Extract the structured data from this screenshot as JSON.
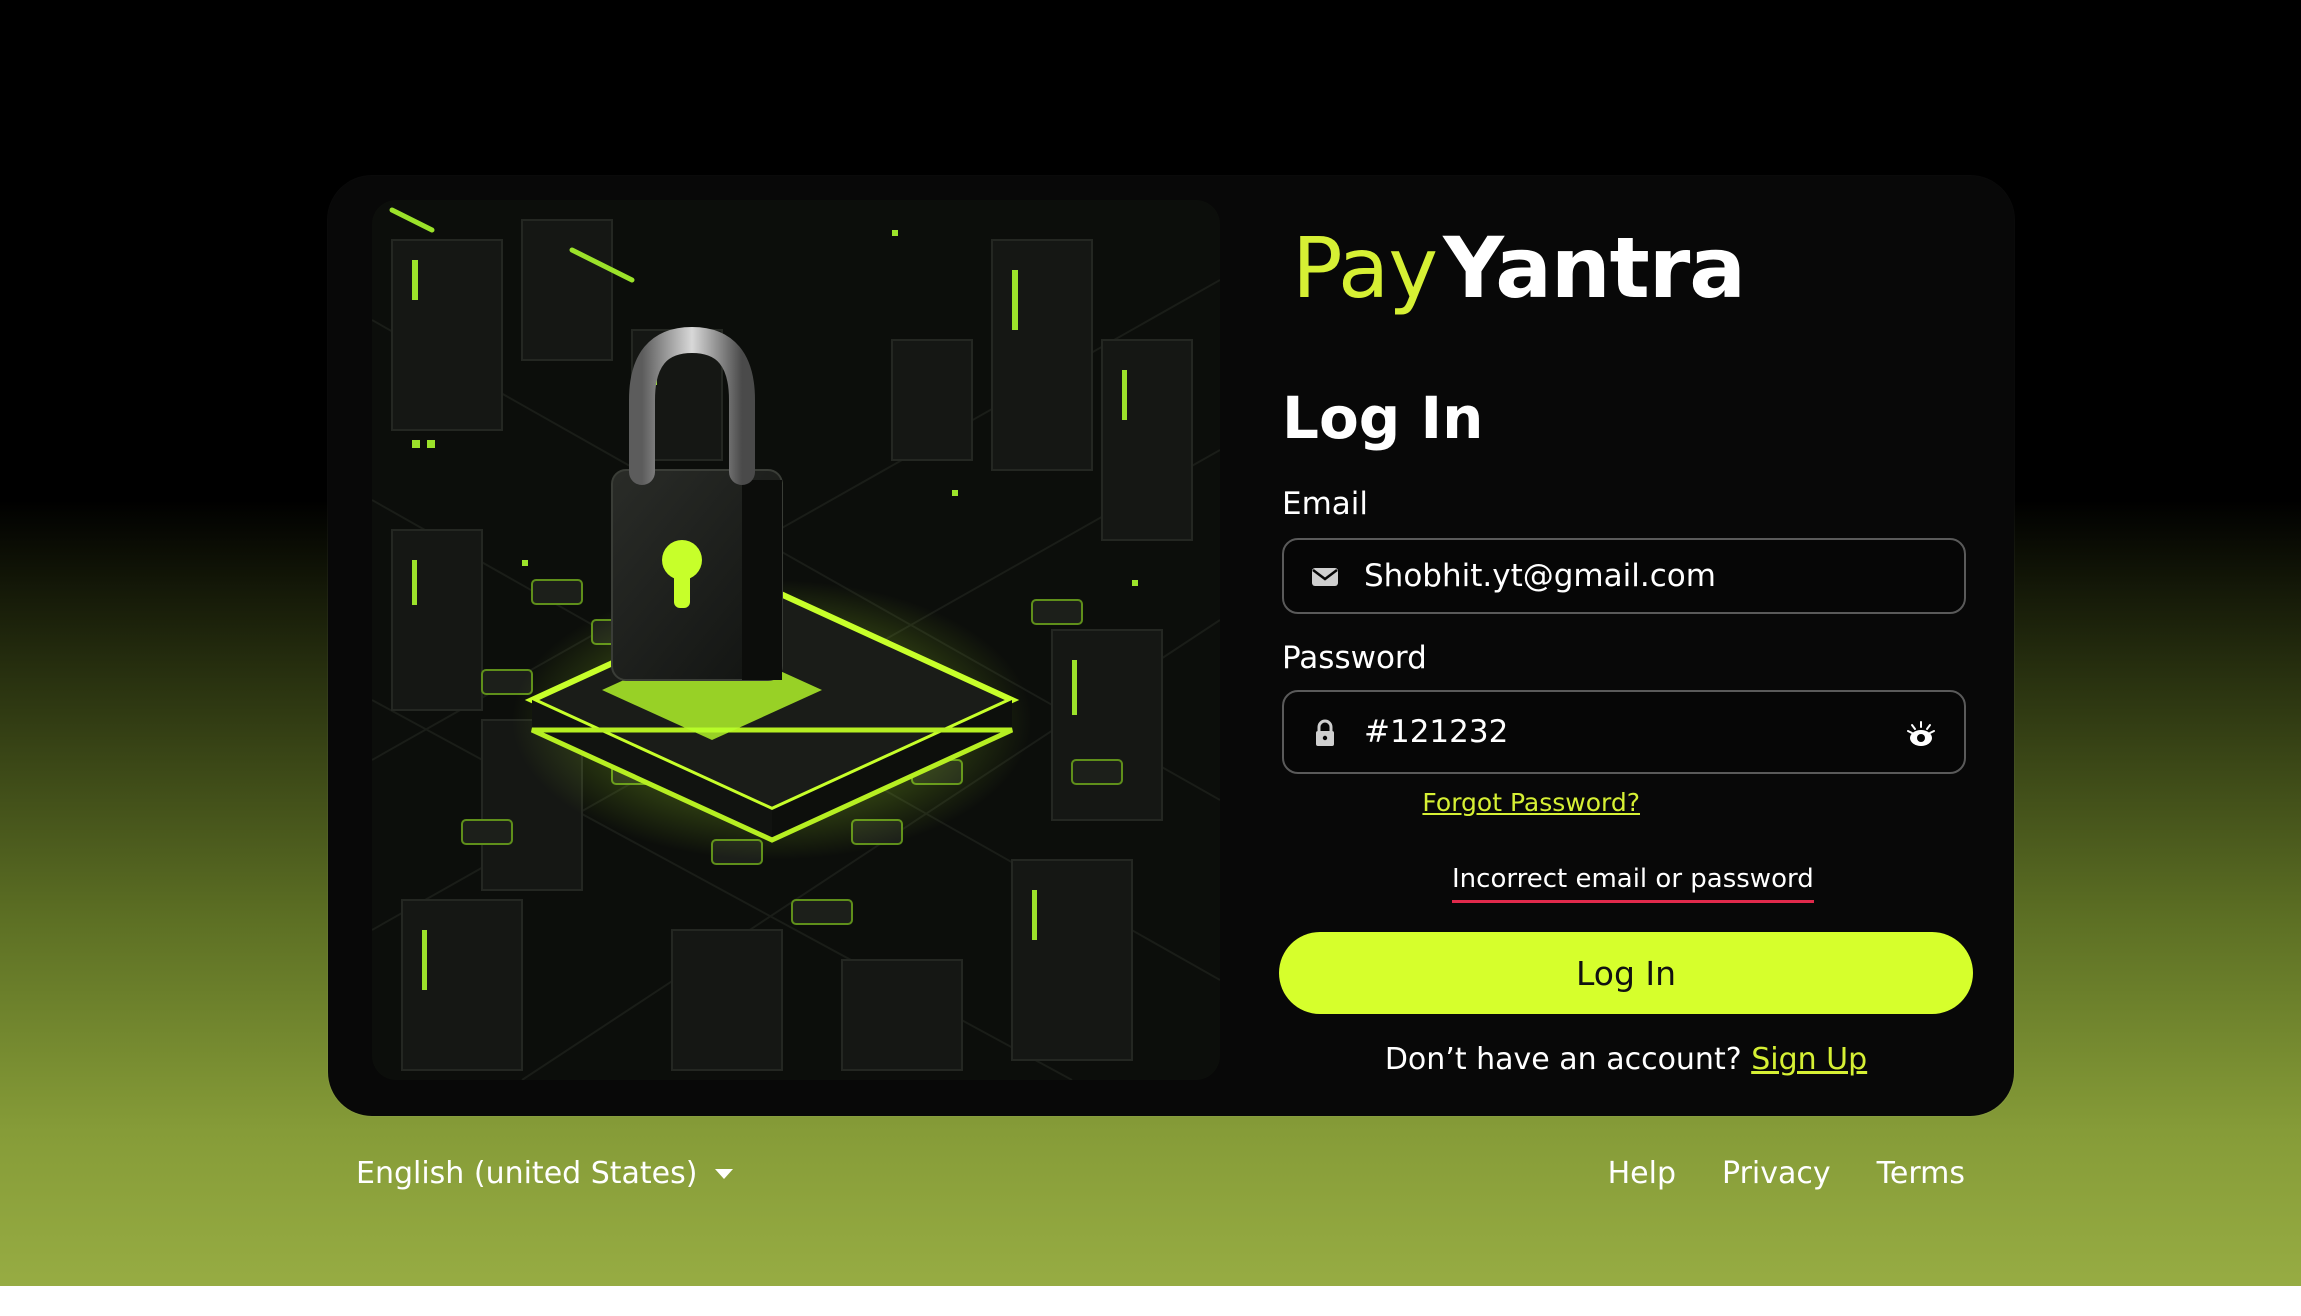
{
  "brand": {
    "part1": "Pay",
    "part2": "Yantra"
  },
  "form": {
    "heading": "Log In",
    "email_label": "Email",
    "email_value": "Shobhit.yt@gmail.com",
    "password_label": "Password",
    "password_value": "#121232",
    "forgot_link": "Forgot Password?",
    "error_message": "Incorrect email or password",
    "submit_label": "Log In",
    "signup_prompt": "Don’t have an account?",
    "signup_link": "Sign Up"
  },
  "icons": {
    "email": "envelope-icon",
    "password": "lock-icon",
    "reveal": "eye-icon",
    "language": "chevron-down-icon"
  },
  "footer": {
    "language": "English (united States)",
    "links": [
      "Help",
      "Privacy",
      "Terms"
    ]
  },
  "colors": {
    "accent": "#d6ff2c",
    "error_underline": "#e0294b",
    "card_bg": "#080808"
  }
}
